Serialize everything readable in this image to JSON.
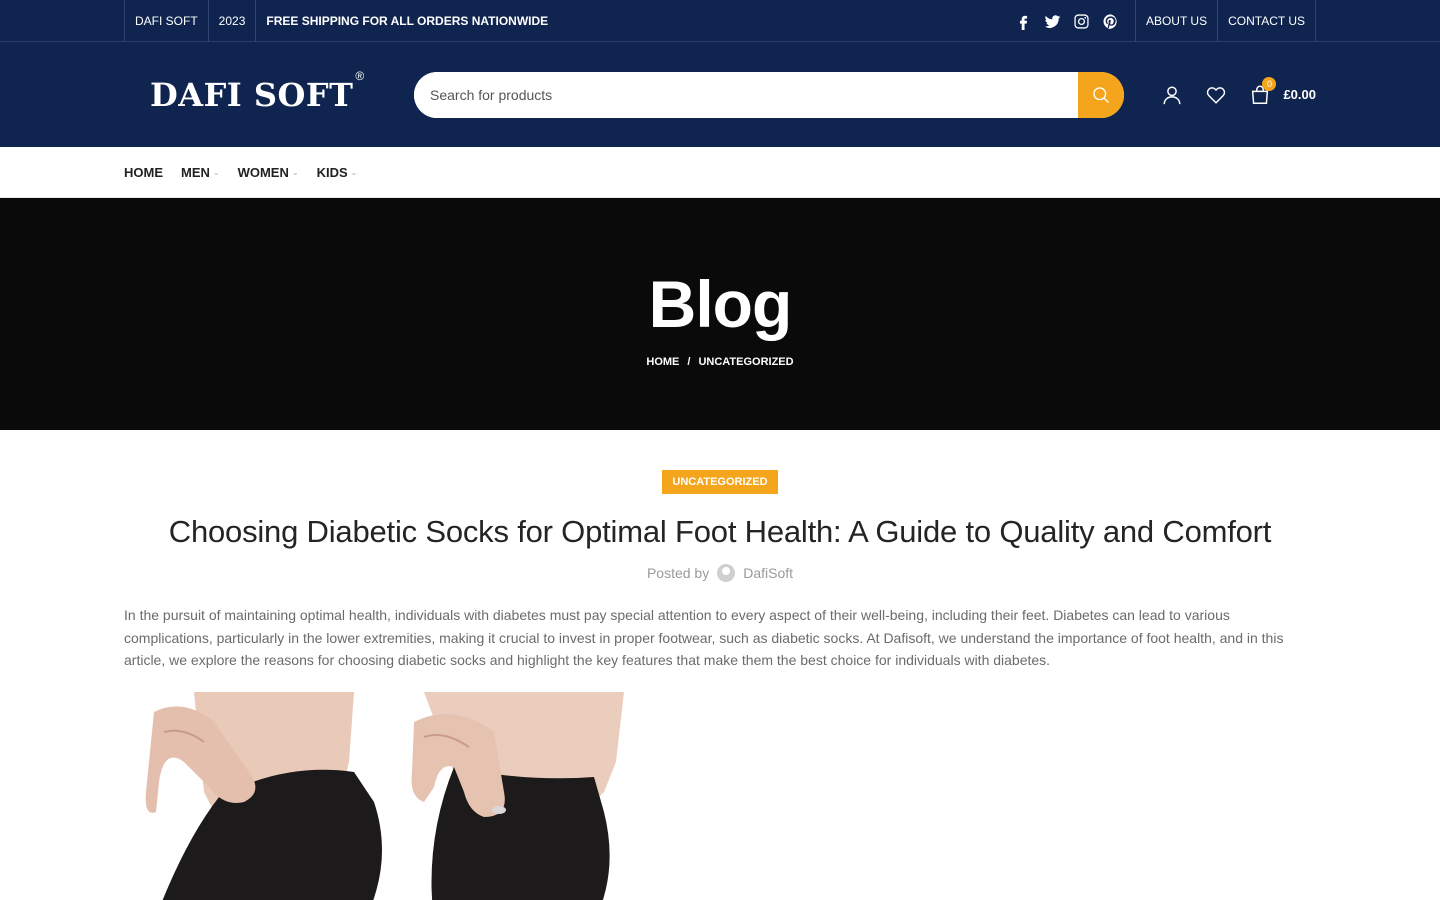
{
  "topbar": {
    "brand": "DAFI SOFT",
    "year": "2023",
    "shipping": "FREE SHIPPING FOR ALL ORDERS NATIONWIDE",
    "links": [
      "ABOUT US",
      "CONTACT US"
    ],
    "socials": [
      "facebook-icon",
      "twitter-icon",
      "instagram-icon",
      "pinterest-icon"
    ]
  },
  "header": {
    "logo": "DAFI SOFT",
    "logo_mark": "®",
    "search_placeholder": "Search for products",
    "cart_count": "0",
    "cart_total": "£0.00"
  },
  "nav": {
    "items": [
      "HOME",
      "MEN",
      "WOMEN",
      "KIDS"
    ]
  },
  "hero": {
    "title": "Blog",
    "breadcrumb": [
      "HOME",
      "/",
      "UNCATEGORIZED"
    ]
  },
  "post": {
    "category": "UNCATEGORIZED",
    "title": "Choosing Diabetic Socks for Optimal Foot Health: A Guide to Quality and Comfort",
    "posted_by": "Posted by",
    "author": "DafiSoft",
    "intro": "In the pursuit of maintaining optimal health, individuals with diabetes must pay special attention to every aspect of their well-being, including their feet. Diabetes can lead to various complications, particularly in the lower extremities, making it crucial to invest in proper footwear, such as diabetic socks. At Dafisoft, we understand the importance of foot health, and in this article, we explore the reasons for choosing diabetic socks and highlight the key features that make them the best choice for individuals with diabetes."
  },
  "colors": {
    "navy": "#0f2550",
    "accent": "#f4a51c",
    "hero_bg": "#0a0a0a"
  }
}
